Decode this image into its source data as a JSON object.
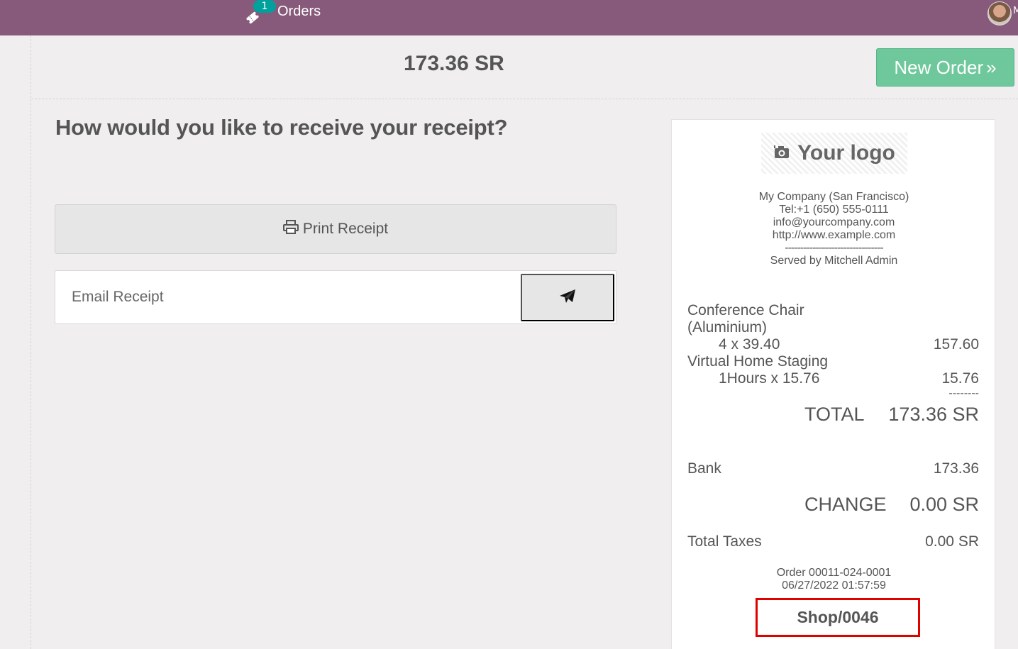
{
  "topbar": {
    "orders_label": "Orders",
    "orders_badge": "1",
    "user_initial": "M"
  },
  "header": {
    "total": "173.36 SR",
    "new_order_label": "New Order",
    "new_order_icon": "»"
  },
  "main": {
    "question": "How would you like to receive your receipt?",
    "print_label": "Print Receipt",
    "email_placeholder": "Email Receipt"
  },
  "receipt": {
    "logo_text": "Your logo",
    "company": {
      "name": "My Company (San Francisco)",
      "tel": "Tel:+1 (650) 555-0111",
      "email": "info@yourcompany.com",
      "website": "http://www.example.com",
      "separator": "--------------------------------",
      "served_by": "Served by Mitchell Admin"
    },
    "lines": [
      {
        "name1": "Conference Chair",
        "name2": "(Aluminium)",
        "qty": "4 x 39.40",
        "amount": "157.60"
      },
      {
        "name1": "Virtual Home Staging",
        "qty": "1Hours x 15.76",
        "amount": "15.76"
      }
    ],
    "subtotal_sep": "--------",
    "total_label": "TOTAL",
    "total_value": "173.36 SR",
    "payment_label": "Bank",
    "payment_value": "173.36",
    "change_label": "CHANGE",
    "change_value": "0.00 SR",
    "taxes_label": "Total Taxes",
    "taxes_value": "0.00 SR",
    "order_number": "Order 00011-024-0001",
    "order_datetime": "06/27/2022 01:57:59",
    "ticket_code": "Shop/0046"
  },
  "colors": {
    "topbar": "#875a7b",
    "accent_green": "#6ec89b",
    "badge": "#00a09d",
    "highlight_box": "#e00000"
  },
  "icons": {
    "orders": "ticket-icon",
    "print": "printer-icon",
    "send": "paper-plane-icon",
    "logo": "camera-icon"
  }
}
